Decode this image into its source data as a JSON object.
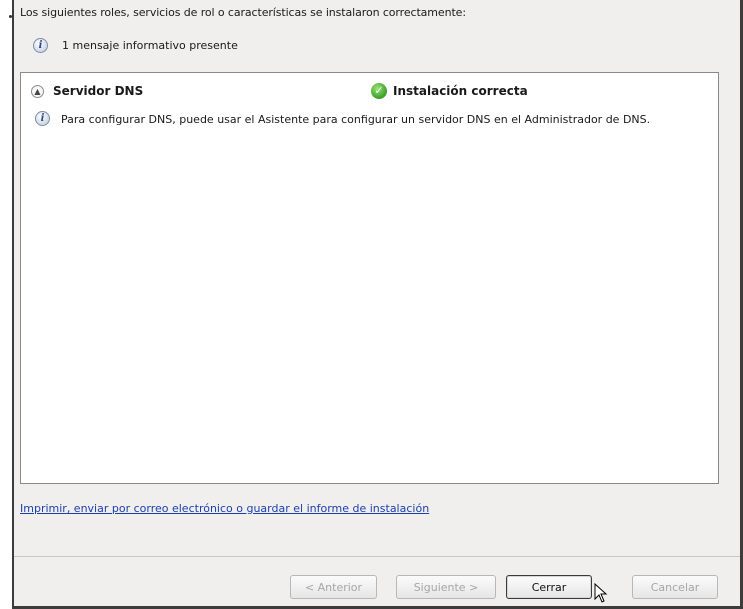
{
  "intro_text": "Los siguientes roles, servicios de rol o características se instalaron correctamente:",
  "message_count_text": "1 mensaje informativo presente",
  "results": [
    {
      "name": "Servidor DNS",
      "status": "Instalación correcta",
      "detail": "Para configurar DNS, puede usar el Asistente para configurar un servidor DNS en el Administrador de DNS."
    }
  ],
  "report_link": "Imprimir, enviar por correo electrónico o guardar el informe de instalación",
  "buttons": {
    "previous": "< Anterior",
    "next": "Siguiente >",
    "close": "Cerrar",
    "cancel": "Cancelar"
  },
  "colors": {
    "dialog_background": "#f0efed",
    "link": "#1b3fae",
    "success": "#3ea32c"
  },
  "icons": {
    "info": "info-icon",
    "collapse": "chevron-up-icon",
    "success": "check-icon"
  }
}
